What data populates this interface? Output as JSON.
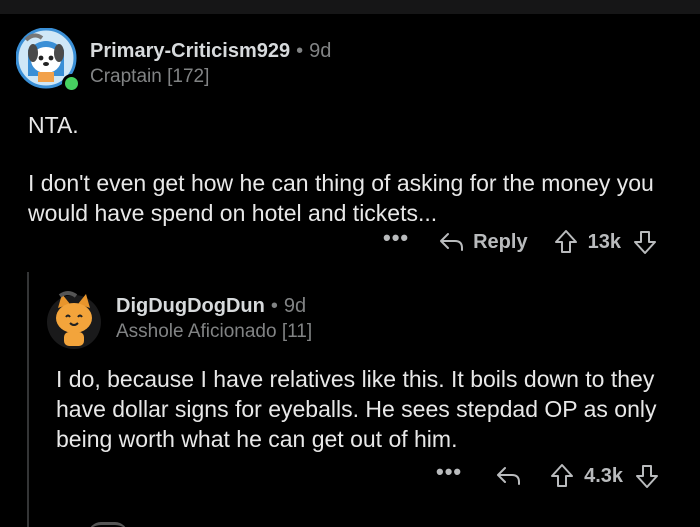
{
  "comments": [
    {
      "username": "Primary-Criticism929",
      "age": "9d",
      "flair": "Craptain [172]",
      "body": [
        "NTA.",
        "I don't even get how he can thing of asking for the money you would have spend on hotel and tickets..."
      ],
      "actions": {
        "more": "•••",
        "reply": "Reply",
        "score": "13k"
      }
    },
    {
      "username": "DigDugDogDun",
      "age": "9d",
      "flair": "Asshole Aficionado [11]",
      "body": [
        "I do, because I have relatives like this. It boils down to they have dollar signs for eyeballs. He sees stepdad OP as only being worth what he can get out of him."
      ],
      "actions": {
        "more": "•••",
        "score": "4.3k"
      }
    }
  ],
  "colors": {
    "background": "#000000",
    "text": "#d7dadc",
    "meta": "#818384",
    "online": "#46d160",
    "avatar_bg": "#3a8fd6"
  },
  "icons": [
    "dog-avatar",
    "online-dot-icon",
    "cat-avatar",
    "reply-arrow-icon",
    "upvote-icon",
    "downvote-icon",
    "more-icon"
  ]
}
